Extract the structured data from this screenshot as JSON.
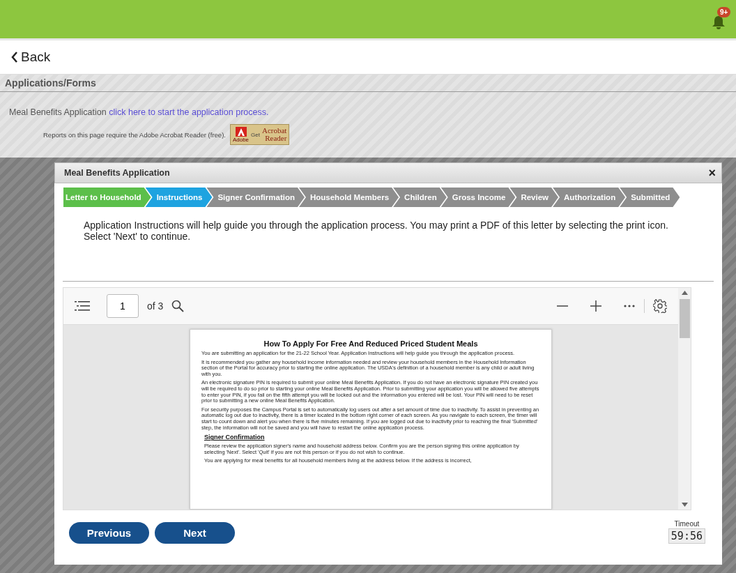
{
  "top_bar": {
    "notification_badge": "9+"
  },
  "back": {
    "label": "Back"
  },
  "section": {
    "title": "Applications/Forms",
    "item_label": "Meal Benefits Application",
    "item_link": "click here to start the application process.",
    "reader_note": "Reports on this page require the Adobe Acrobat Reader (free).",
    "reader_badge": {
      "small": "Get",
      "name": "Acrobat",
      "name2": "Reader",
      "brand": "Adobe"
    }
  },
  "dialog": {
    "title": "Meal Benefits Application",
    "close": "×",
    "steps": [
      {
        "label": "Letter to Household",
        "completed": true,
        "selected": false
      },
      {
        "label": "Instructions",
        "completed": false,
        "selected": true
      },
      {
        "label": "Signer Confirmation",
        "completed": false,
        "selected": false
      },
      {
        "label": "Household Members",
        "completed": false,
        "selected": false
      },
      {
        "label": "Children",
        "completed": false,
        "selected": false
      },
      {
        "label": "Gross Income",
        "completed": false,
        "selected": false
      },
      {
        "label": "Review",
        "completed": false,
        "selected": false
      },
      {
        "label": "Authorization",
        "completed": false,
        "selected": false
      },
      {
        "label": "Submitted",
        "completed": false,
        "selected": false
      }
    ],
    "instructions": "Application Instructions will help guide you through the application process. You may print a PDF of this letter by selecting the print icon. Select 'Next' to continue.",
    "viewer": {
      "page": "1",
      "page_total": "of 3",
      "document": {
        "title": "How To Apply For Free And Reduced Priced Student Meals",
        "blocks": [
          {
            "kind": "paragraph",
            "text": "You are submitting an application for the 21-22 School Year. Application Instructions will help guide you through the application process."
          },
          {
            "kind": "paragraph",
            "text": "It is recommended you gather any household income information needed and review your household members in the Household Information section of the Portal for accuracy prior to starting the online application. The USDA's definition of a household member is any child or adult living with you."
          },
          {
            "kind": "paragraph",
            "text": "An electronic signature PIN is required to submit your online Meal Benefits Application. If you do not have an electronic signature PIN created you will be required to do so prior to starting your online Meal Benefits Application. Prior to submitting your application you will be allowed five attempts to enter your PIN, if you fail on the fifth attempt you will be locked out and the information you entered will be lost. Your PIN will need to be reset prior to submitting a new online Meal Benefits Application."
          },
          {
            "kind": "paragraph",
            "text": "For security purposes the Campus Portal is set to automatically log users out after a set amount of time due to inactivity. To assist in preventing an automatic log out due to inactivity, there is a timer located in the bottom right corner of each screen. As you navigate to each screen, the timer will start to count down and alert you when there is five minutes remaining. If you are logged out due to inactivity prior to reaching the final 'Submitted' step, the information will not be saved and you will have to restart the online application process."
          },
          {
            "kind": "heading",
            "text": "Signer Confirmation"
          },
          {
            "kind": "indented",
            "text": "Please review the application signer's name and household address below. Confirm you are the person signing this online application by selecting 'Next'. Select 'Quit' if you are not this person or if you do not wish to continue."
          },
          {
            "kind": "indented",
            "text": "You are applying for meal benefits for all household members living at the address below. If the address is incorrect,"
          }
        ]
      }
    },
    "buttons": [
      {
        "label": "Previous"
      },
      {
        "label": "Next"
      }
    ],
    "timeout": {
      "label": "Timeout",
      "value": "59:56"
    }
  }
}
